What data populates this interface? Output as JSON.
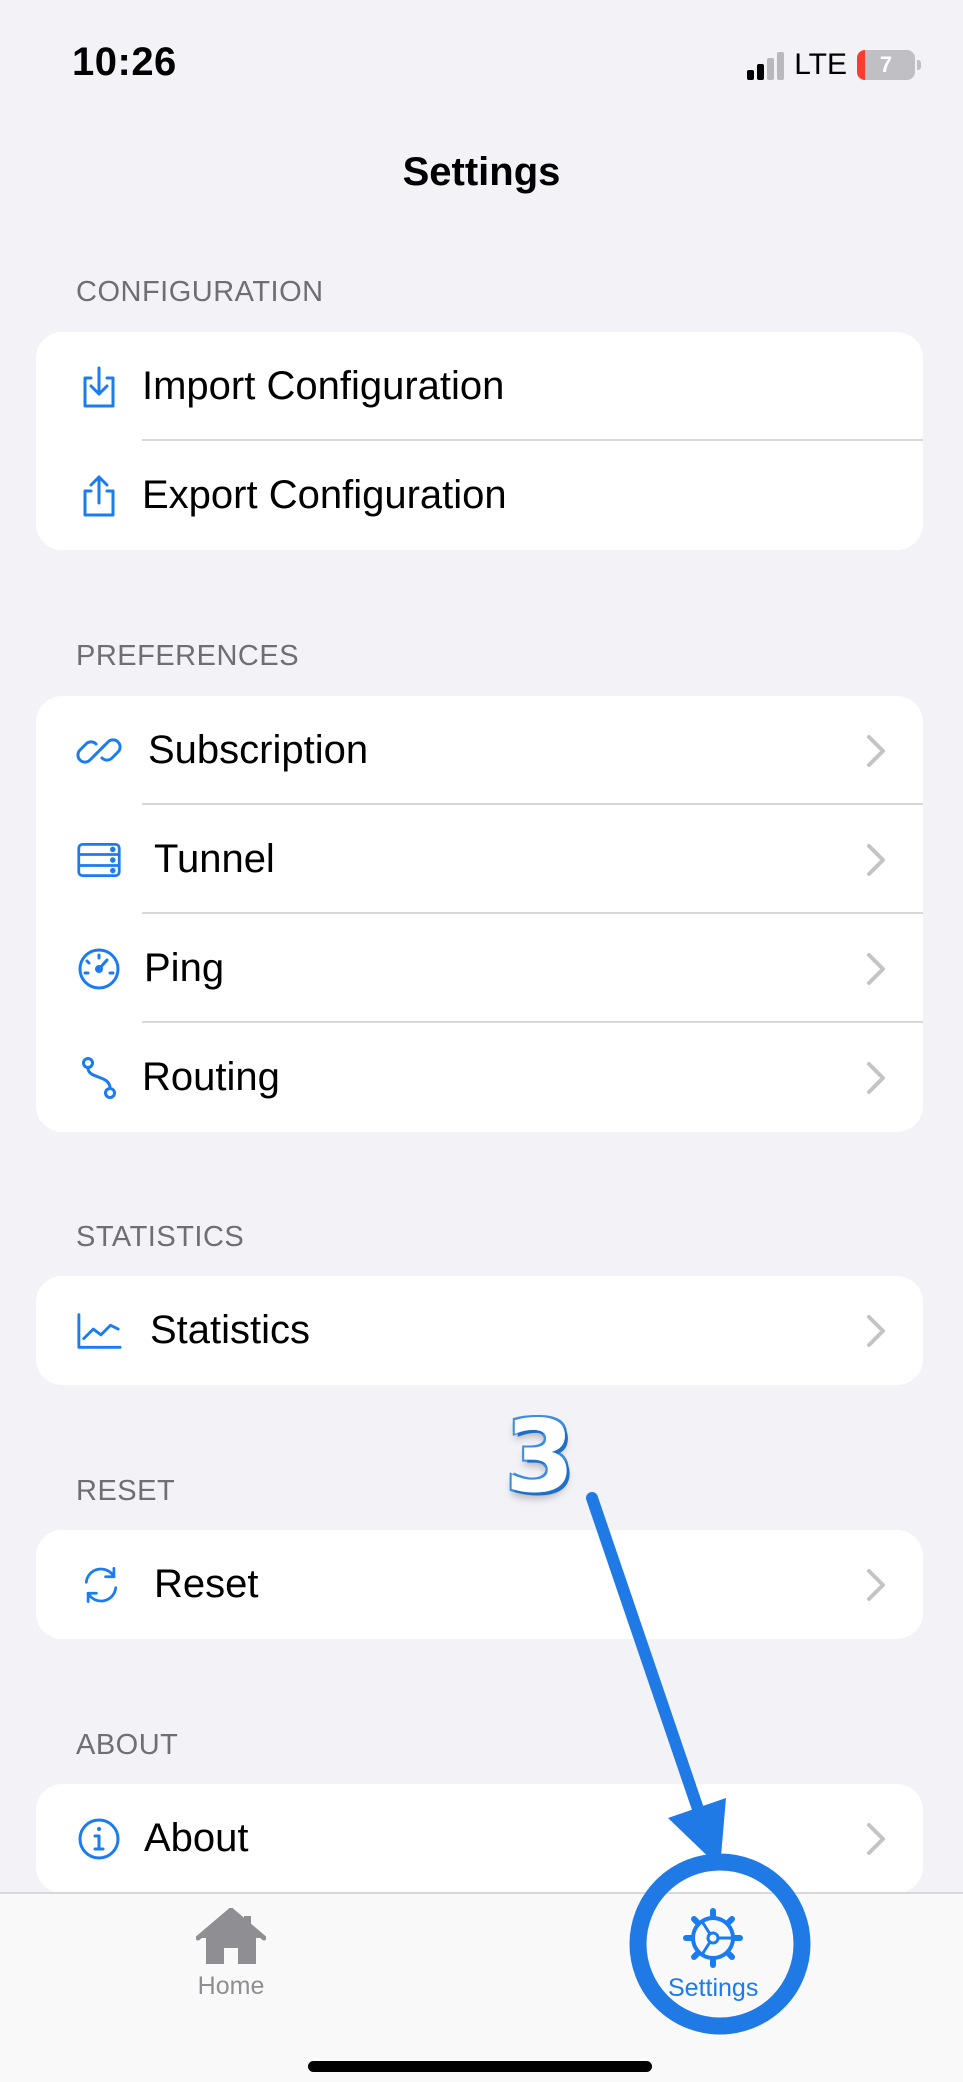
{
  "status_bar": {
    "time": "10:26",
    "network": "LTE",
    "battery_level": "7"
  },
  "nav": {
    "title": "Settings"
  },
  "sections": {
    "configuration": {
      "header": "CONFIGURATION",
      "items": [
        {
          "label": "Import Configuration",
          "icon": "import-icon"
        },
        {
          "label": "Export Configuration",
          "icon": "share-icon"
        }
      ]
    },
    "preferences": {
      "header": "PREFERENCES",
      "items": [
        {
          "label": "Subscription",
          "icon": "link-icon"
        },
        {
          "label": "Tunnel",
          "icon": "server-icon"
        },
        {
          "label": "Ping",
          "icon": "speedometer-icon"
        },
        {
          "label": "Routing",
          "icon": "route-icon"
        }
      ]
    },
    "statistics": {
      "header": "STATISTICS",
      "items": [
        {
          "label": "Statistics",
          "icon": "chart-icon"
        }
      ]
    },
    "reset": {
      "header": "RESET",
      "items": [
        {
          "label": "Reset",
          "icon": "refresh-icon"
        }
      ]
    },
    "about": {
      "header": "ABOUT",
      "items": [
        {
          "label": "About",
          "icon": "info-icon"
        }
      ]
    }
  },
  "tab_bar": {
    "tabs": [
      {
        "label": "Home",
        "icon": "house-icon",
        "selected": false
      },
      {
        "label": "Settings",
        "icon": "gear-icon",
        "selected": true
      }
    ]
  },
  "annotation": {
    "step": "3"
  },
  "colors": {
    "accent": "#1a7cf0",
    "background": "#f2f2f7",
    "annotation": "#1f7ae6",
    "inactive_tab": "#8e8e93"
  }
}
